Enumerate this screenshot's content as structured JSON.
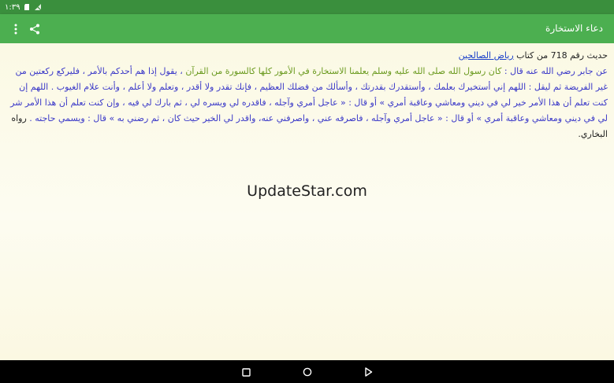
{
  "status_bar": {
    "time": "١:٣٩"
  },
  "app_bar": {
    "title": "دعاء الاستخارة",
    "share_icon": "share-icon",
    "menu_icon": "more-vert-icon"
  },
  "hadith": {
    "prefix": "حديث رقم 718 من كتاب ",
    "book": "رياض الصالحين",
    "narrator": "عن جابر رضي الله عنه قال : ",
    "green_1": "كان رسول الله صلى الله عليه وسلم يعلمنا الاستخارة في الأمور كلها كالسورة من القرآن",
    "blue_1": " ، يقول إذا هم أحدكم بالأمر ، فليركع ركعتين من غير الفريضة ثم ليقل : اللهم إني أستخيرك بعلمك ، وأستقدرك بقدرتك ، وأسألك من فضلك العظيم ، فإنك تقدر ولا أقدر ، وتعلم ولا أعلم ، وأنت علام الغيوب . اللهم إن كنت تعلم أن هذا الأمر خير لي في ديني ومعاشي وعاقبة أمري » أو قال : « عاجل أمري وآجله ، فاقدره لي ويسره لي ، ثم بارك لي فيه ، وإن كنت تعلم أن هذا الأمر شر لي في ديني ومعاشي وعاقبة أمري » أو قال : « عاجل أمري وآجله ، فاصرفه عني ، واصرفني عنه، واقدر لي الخير حيث كان ، ثم رضني به » قال : ويسمي حاجته .",
    "ending": " رواه البخاري."
  },
  "watermark": "UpdateStar.com",
  "nav": {
    "back_icon": "back-icon",
    "home_icon": "home-icon",
    "recents_icon": "recents-icon"
  },
  "colors": {
    "status_bar": "#3a8f3d",
    "app_bar": "#4caf50",
    "background": "#fbf9e6",
    "blue_text": "#3a38c8",
    "green_text": "#6a9a1f",
    "link": "#1a3fc9"
  }
}
